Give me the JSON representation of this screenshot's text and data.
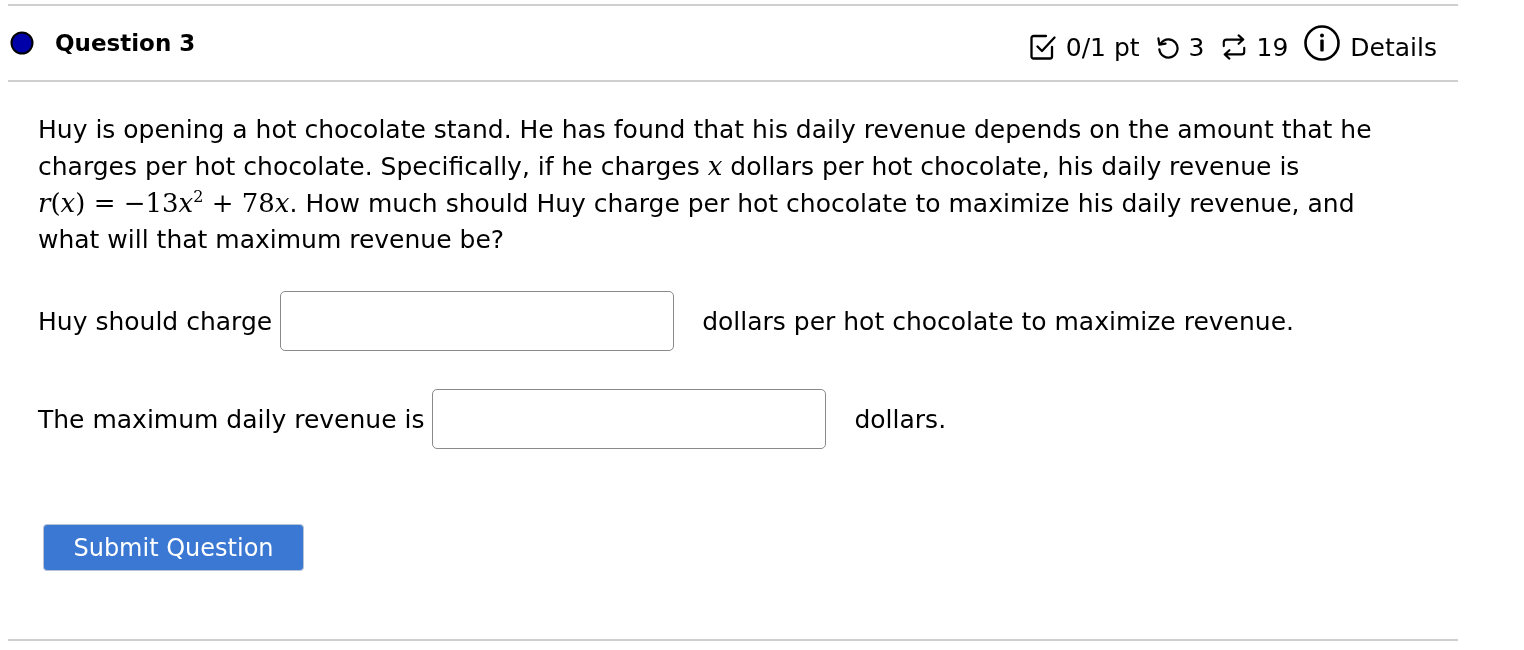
{
  "header": {
    "title": "Question 3",
    "meta": [
      {
        "kind": "score",
        "text": "0/1 pt"
      },
      {
        "kind": "attempts",
        "text": "3"
      },
      {
        "kind": "versions",
        "text": "19"
      },
      {
        "kind": "details",
        "text": "Details"
      }
    ]
  },
  "question": {
    "segments": [
      {
        "kind": "text",
        "text": "Huy is opening a hot chocolate stand. He has found that his daily revenue depends on the amount that he charges per hot chocolate. Specifically, if he charges "
      },
      {
        "kind": "math",
        "text": "*x*"
      },
      {
        "kind": "text",
        "text": " dollars per hot chocolate, his daily revenue is "
      },
      {
        "kind": "math",
        "text": "*r*(*x*) = −13"
      },
      {
        "kind": "math",
        "text": "*x*$^{2}$ + 78"
      },
      {
        "kind": "math",
        "text": "*x*"
      },
      {
        "kind": "text",
        "text": ". How much should Huy charge per hot chocolate to maximize his daily revenue, and what will that maximum revenue be?"
      }
    ]
  },
  "answers": [
    {
      "prefix": "Huy should charge",
      "suffix": "dollars per hot chocolate to maximize revenue."
    },
    {
      "prefix": "The maximum daily revenue is",
      "suffix": "dollars."
    }
  ],
  "submit_button": "Submit Question"
}
